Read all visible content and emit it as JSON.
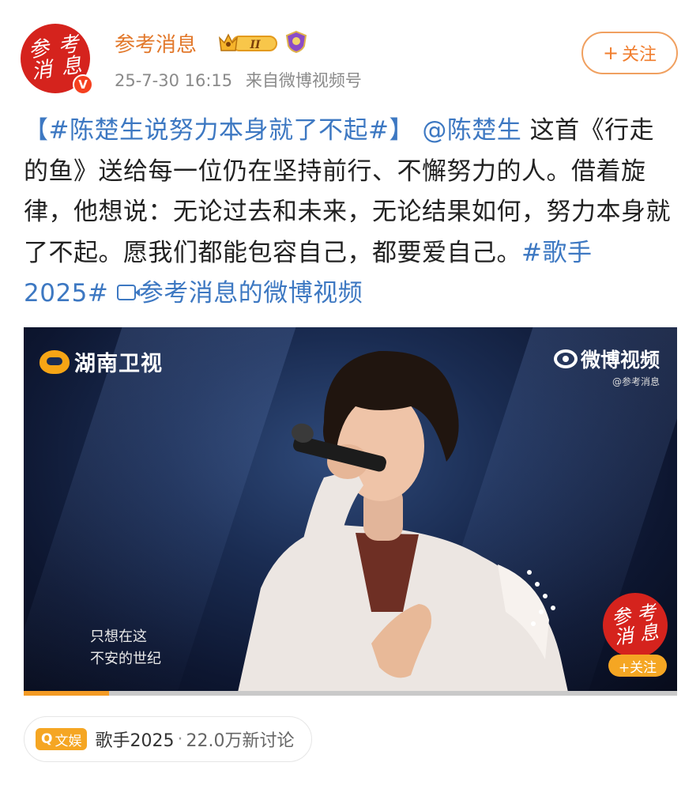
{
  "account": {
    "name": "参考消息",
    "verified_mark": "V",
    "avatar_logo": [
      "参",
      "考",
      "消",
      "息"
    ],
    "level_badge": "II",
    "timestamp": "25-7-30 16:15",
    "source": "来自微博视频号",
    "follow_label": "关注",
    "follow_icon": "+"
  },
  "post": {
    "hashtag": "【#陈楚生说努力本身就了不起#】",
    "mention": "@陈楚生",
    "body": " 这首《行走的鱼》送给每一位仍在坚持前行、不懈努力的人。借着旋律，他想说：无论过去和未来，无论结果如何，努力本身就了不起。愿我们都能包容自己，都要爱自己。",
    "hashtag2": "#歌手 2025#",
    "video_link": "参考消息的微博视频"
  },
  "video": {
    "channel_logo": "湖南卫视",
    "weibo_logo": "微博视频",
    "weibo_sub": "@参考消息",
    "lyric_line1": "只想在这",
    "lyric_line2": "不安的世纪",
    "watermark_follow": "+关注",
    "progress": 0.13
  },
  "topic": {
    "tag_icon": "Q",
    "tag": "文娱",
    "name": "歌手2025",
    "separator": "·",
    "count": "22.0万新讨论"
  },
  "colors": {
    "accent_orange": "#f07d2d",
    "link_blue": "#3d78c2",
    "brand_red": "#d5231d",
    "tag_orange": "#f5a623"
  }
}
